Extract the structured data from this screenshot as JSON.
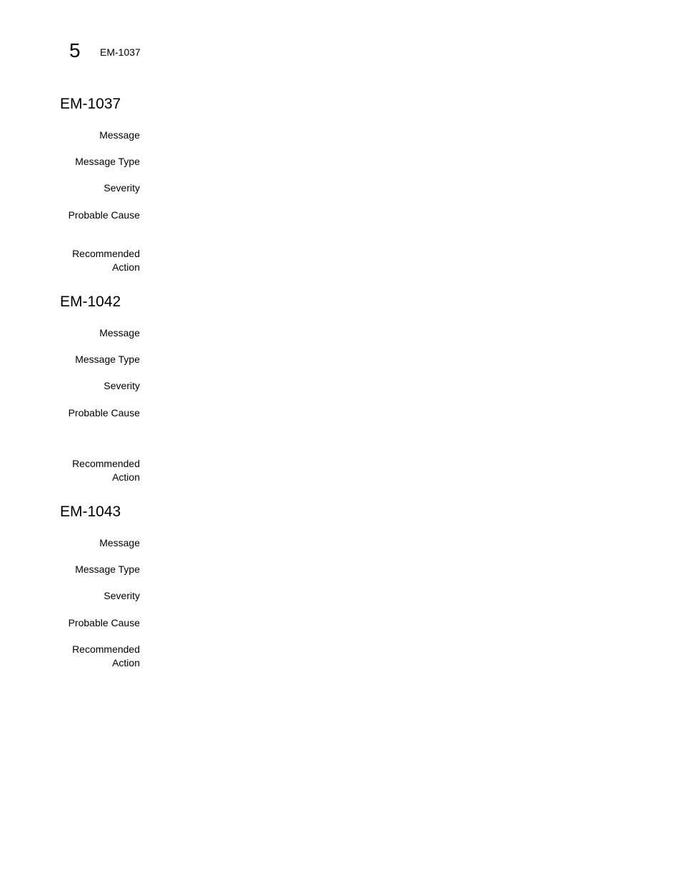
{
  "header": {
    "chapter_number": "5",
    "running_title": "EM-1037"
  },
  "sections": [
    {
      "title": "EM-1037",
      "fields": [
        {
          "label": "Message",
          "value": ""
        },
        {
          "label": "Message Type",
          "value": ""
        },
        {
          "label": "Severity",
          "value": ""
        },
        {
          "label": "Probable Cause",
          "value": ""
        },
        {
          "label": "Recommended Action",
          "label_line1": "Recommended",
          "label_line2": "Action",
          "value": ""
        }
      ]
    },
    {
      "title": "EM-1042",
      "fields": [
        {
          "label": "Message",
          "value": ""
        },
        {
          "label": "Message Type",
          "value": ""
        },
        {
          "label": "Severity",
          "value": ""
        },
        {
          "label": "Probable Cause",
          "value": ""
        },
        {
          "label": "Recommended Action",
          "label_line1": "Recommended",
          "label_line2": "Action",
          "value": ""
        }
      ]
    },
    {
      "title": "EM-1043",
      "fields": [
        {
          "label": "Message",
          "value": ""
        },
        {
          "label": "Message Type",
          "value": ""
        },
        {
          "label": "Severity",
          "value": ""
        },
        {
          "label": "Probable Cause",
          "value": ""
        },
        {
          "label": "Recommended Action",
          "label_line1": "Recommended",
          "label_line2": "Action",
          "value": ""
        }
      ]
    }
  ]
}
